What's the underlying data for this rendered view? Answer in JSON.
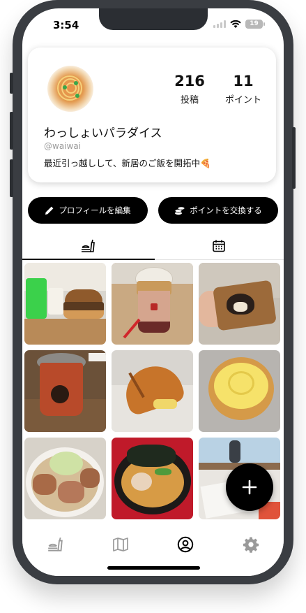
{
  "status_bar": {
    "time": "3:54",
    "battery": "19"
  },
  "profile": {
    "name": "わっしょいパラダイス",
    "handle": "@waiwai",
    "bio": "最近引っ越しして、新居のご飯を開拓中🍕",
    "stats": [
      {
        "value": "216",
        "label": "投稿"
      },
      {
        "value": "11",
        "label": "ポイント"
      }
    ]
  },
  "actions": {
    "edit_profile": "プロフィールを編集",
    "exchange_points": "ポイントを交換する"
  },
  "tabs": [
    {
      "icon": "food-icon",
      "selected": true
    },
    {
      "icon": "calendar-icon",
      "selected": false
    }
  ],
  "posts": [
    {
      "subject": "burger-and-melon-soda"
    },
    {
      "subject": "bubble-tea"
    },
    {
      "subject": "shiba-pastry-box"
    },
    {
      "subject": "iced-tea-cup"
    },
    {
      "subject": "bread-roll"
    },
    {
      "subject": "custard-bun"
    },
    {
      "subject": "ramen-chashu"
    },
    {
      "subject": "iekei-ramen"
    },
    {
      "subject": "restaurant-interior"
    }
  ],
  "bottom_nav": [
    {
      "icon": "food-icon",
      "active": false
    },
    {
      "icon": "map-icon",
      "active": false
    },
    {
      "icon": "profile-icon",
      "active": true
    },
    {
      "icon": "gear-icon",
      "active": false
    }
  ],
  "colors": {
    "accent": "#000000",
    "inactive_icon": "#9a9a9a"
  }
}
